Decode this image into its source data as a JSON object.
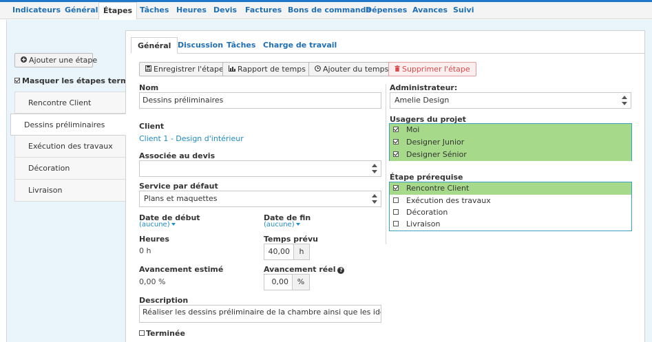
{
  "nav": {
    "items": [
      "Indicateurs",
      "Général",
      "Étapes",
      "Tâches",
      "Heures",
      "Devis",
      "Factures",
      "Bons de commande",
      "Dépenses",
      "Avances",
      "Suivi"
    ]
  },
  "sidebar": {
    "add_step_label": "Ajouter une étape",
    "hide_completed_label": "Masquer les étapes terminées",
    "steps": [
      "Rencontre Client",
      "Dessins préliminaires",
      "Exécution des travaux",
      "Décoration",
      "Livraison"
    ]
  },
  "tabs": [
    "Général",
    "Discussion",
    "Tâches",
    "Charge de travail"
  ],
  "toolbar": {
    "save_label": "Enregistrer l'étape",
    "time_report_label": "Rapport de temps",
    "add_time_label": "Ajouter du temps",
    "delete_label": "Supprimer l'étape"
  },
  "form": {
    "name_label": "Nom",
    "name_value": "Dessins préliminaires",
    "client_label": "Client",
    "client_value": "Client 1 - Design d'intérieur",
    "quote_label": "Associée au devis",
    "quote_value": "",
    "service_label": "Service par défaut",
    "service_value": "Plans et maquettes",
    "start_label": "Date de début",
    "start_value": "(aucune)",
    "end_label": "Date de fin",
    "end_value": "(aucune)",
    "hours_label": "Heures",
    "hours_value": "0 h",
    "planned_label": "Temps prévu",
    "planned_value": "40,00",
    "planned_unit": "h",
    "est_progress_label": "Avancement estimé",
    "est_progress_value": "0,00 %",
    "real_progress_label": "Avancement réel",
    "real_progress_value": "0,00",
    "real_progress_unit": "%",
    "description_label": "Description",
    "description_value": "Réaliser les dessins préliminaire de la chambre ainsi que les idées déco",
    "completed_label": "Terminée",
    "admin_label": "Administrateur:",
    "admin_value": "Amelie Design",
    "users_label": "Usagers du projet",
    "users": [
      {
        "name": "Moi",
        "checked": true
      },
      {
        "name": "Designer Junior",
        "checked": true
      },
      {
        "name": "Designer Sénior",
        "checked": true
      }
    ],
    "prereq_label": "Étape prérequise",
    "prereqs": [
      {
        "name": "Rencontre Client",
        "checked": true
      },
      {
        "name": "Exécution des travaux",
        "checked": false
      },
      {
        "name": "Décoration",
        "checked": false
      },
      {
        "name": "Livraison",
        "checked": false
      }
    ]
  },
  "colors": {
    "accent": "#1f6fb5",
    "selected_green": "#a6d98a",
    "danger": "#d64b4b",
    "panel_blue": "#eaf4fb"
  }
}
